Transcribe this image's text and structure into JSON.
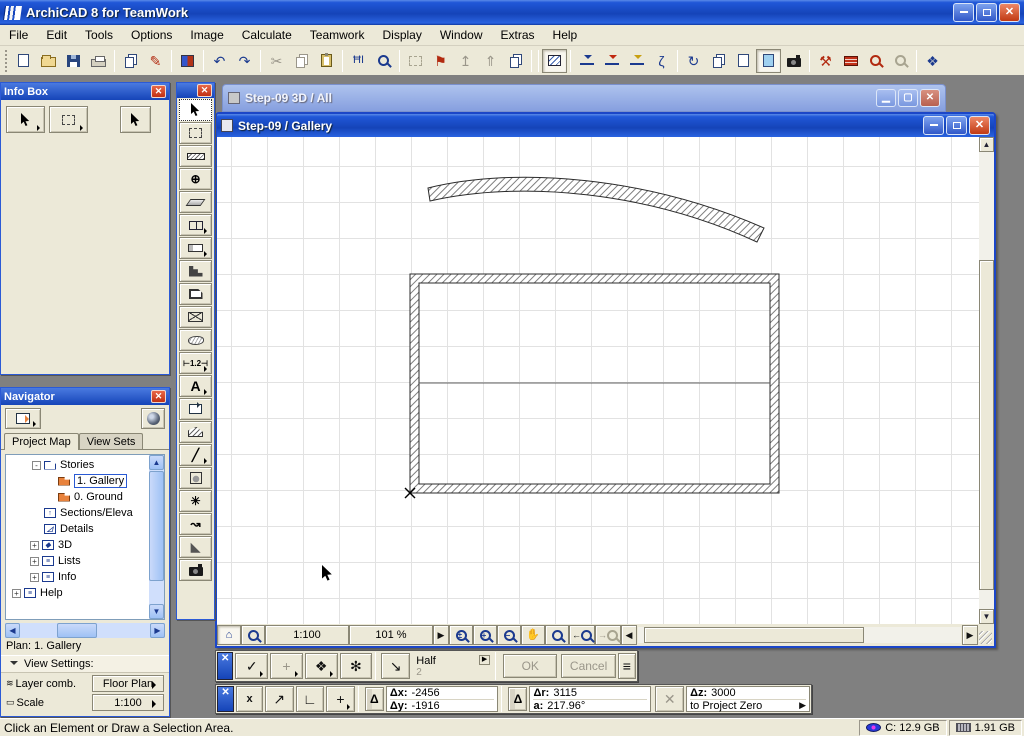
{
  "app": {
    "title": "ArchiCAD 8 for TeamWork"
  },
  "menubar": {
    "items": [
      "File",
      "Edit",
      "Tools",
      "Options",
      "Image",
      "Calculate",
      "Teamwork",
      "Display",
      "Window",
      "Extras",
      "Help"
    ]
  },
  "toolbar": {
    "glyphs": {
      "pen": "✎",
      "undo": "↶",
      "redo": "↷",
      "cut": "✂",
      "dim": "ĦI",
      "flag": "⚑",
      "tup": "↥",
      "up": "⇑",
      "seahorse": "ζ",
      "rotate": "↻",
      "hammer": "⚒",
      "fit": "❖"
    }
  },
  "infobox": {
    "title": "Info Box"
  },
  "toolbox": {
    "glyphs": {
      "column": "⊕",
      "dim": "⊢1.2⊣",
      "text": "A",
      "line": "╱",
      "hotspot": "✳",
      "label": "↝",
      "section": "◣"
    }
  },
  "navigator": {
    "title": "Navigator",
    "tabs": {
      "project_map": "Project Map",
      "view_sets": "View Sets"
    },
    "tree": [
      {
        "exp": "-",
        "label": "Stories"
      },
      {
        "label": "1. Gallery",
        "selected": true
      },
      {
        "label": "0. Ground"
      },
      {
        "label": "Sections/Eleva"
      },
      {
        "label": "Details"
      },
      {
        "exp": "+",
        "label": "3D"
      },
      {
        "exp": "+",
        "label": "Lists"
      },
      {
        "exp": "+",
        "label": "Info"
      },
      {
        "exp": "+",
        "label": "Help"
      }
    ],
    "icons": {
      "sec": "↑",
      "det": "◿",
      "d3": "◆",
      "list": "≡",
      "help": "≡"
    },
    "plan": "Plan: 1. Gallery",
    "view_settings": "View Settings:",
    "layer_icon": "≋",
    "layer_label": "Layer comb.",
    "layer_value": "Floor Plan",
    "scale_icon": "▭",
    "scale_label": "Scale",
    "scale_value": "1:100"
  },
  "windows": {
    "back": {
      "title": "Step-09 3D / All"
    },
    "active": {
      "title": "Step-09 / Gallery"
    }
  },
  "zoombar": {
    "scale": "1:100",
    "zoom": "101 %",
    "glyphs": {
      "house": "⌂",
      "hand": "✋",
      "right": "▶",
      "left": "◀",
      "pm": "±",
      "plus": "+",
      "minus": "−",
      "arrow_left": "←",
      "arrow_right": "→"
    }
  },
  "controlbox": {
    "glyphs": {
      "offset": "✓",
      "plus": "+",
      "cage": "❖",
      "wand": "✻",
      "snap": "↘",
      "menu": "≡",
      "close": "✕"
    },
    "half": "Half",
    "half_sub": "2",
    "ok": "OK",
    "cancel": "Cancel"
  },
  "coordbox": {
    "glyphs": {
      "close": "✕",
      "x": "x",
      "track": "↗",
      "axes": "∟",
      "plus": "+",
      "delta": "Δ",
      "gravity": "✕"
    },
    "dx_label": "Δx:",
    "dx": "-2456",
    "dy_label": "Δy:",
    "dy": "-1916",
    "dr_label": "Δr:",
    "dr": "3115",
    "a_label": "a:",
    "a": "217.96°",
    "dz_label": "Δz:",
    "dz": "3000",
    "ref": "to Project Zero"
  },
  "statusbar": {
    "message": "Click an Element or Draw a Selection Area.",
    "disk": "C: 12.9 GB",
    "mem": "1.91 GB"
  }
}
